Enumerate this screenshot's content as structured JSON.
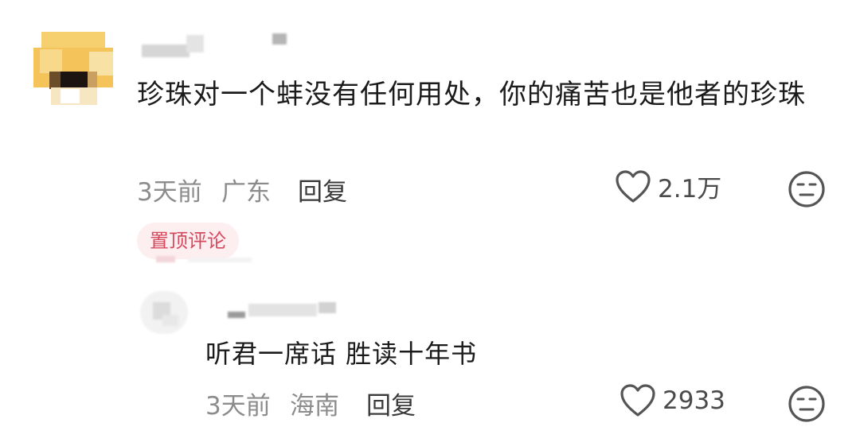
{
  "comment": {
    "text": "珍珠对一个蚌没有任何用处，你的痛苦也是他者的珍珠",
    "time": "3天前",
    "location": "广东",
    "reply_label": "回复",
    "likes": "2.1万",
    "pinned_label": "置顶评论"
  },
  "reply": {
    "text": "听君一席话 胜读十年书",
    "time": "3天前",
    "location": "海南",
    "reply_label": "回复",
    "likes": "2933"
  },
  "icons": {
    "like": "heart-outline-icon",
    "dislike": "neutral-face-icon"
  },
  "colors": {
    "pinned_text": "#d64a5f",
    "pinned_bg": "#fdeef0",
    "meta_text": "#8c8c8c"
  }
}
